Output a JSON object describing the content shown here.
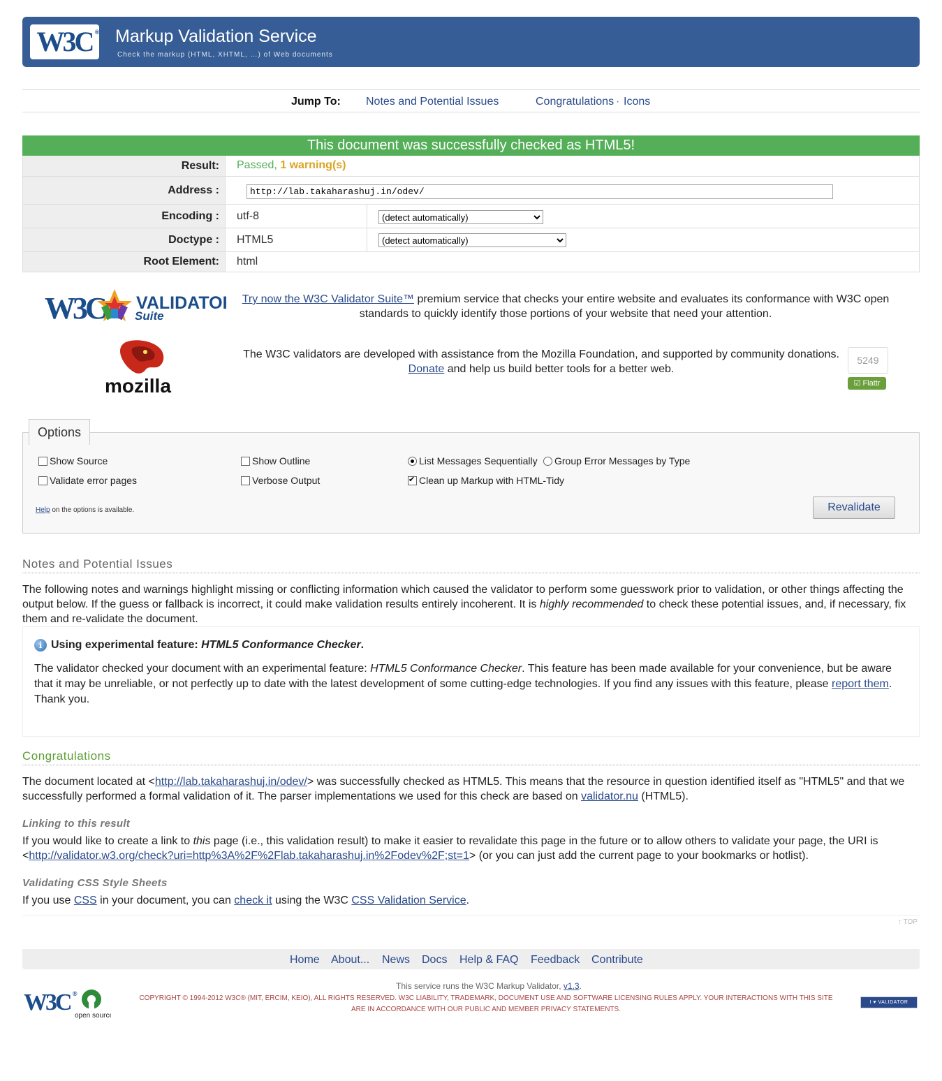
{
  "banner": {
    "title": "Markup Validation Service",
    "subtitle": "Check the markup (HTML, XHTML, …) of Web documents"
  },
  "jump": {
    "label": "Jump To:",
    "notes": "Notes and Potential Issues",
    "congrats": "Congratulations",
    "separator": "·",
    "icons": "Icons"
  },
  "result": {
    "header": "This document was successfully checked as HTML5!",
    "result_label": "Result:",
    "result_passed": "Passed,",
    "result_warning": "1 warning(s)",
    "address_label": "Address :",
    "address_value": "http://lab.takaharashuj.in/odev/",
    "encoding_label": "Encoding :",
    "encoding_value": "utf-8",
    "encoding_select": "(detect automatically)",
    "doctype_label": "Doctype :",
    "doctype_value": "HTML5",
    "doctype_select": "(detect automatically)",
    "root_label": "Root Element:",
    "root_value": "html"
  },
  "promo": {
    "suite_link": "Try now the W3C Validator Suite™",
    "suite_text": " premium service that checks your entire website and evaluates its conformance with W3C open standards to quickly identify those portions of your website that need your attention.",
    "mozilla_text": "The W3C validators are developed with assistance from the Mozilla Foundation, and supported by community donations.",
    "donate_link": "Donate",
    "donate_text": " and help us build better tools for a better web.",
    "donation_count": "5249",
    "flattr_label": "Flattr",
    "mozilla_word": "mozilla",
    "suite_word": "VALIDATOR",
    "suite_sub": "Suite"
  },
  "options": {
    "tab_label": "Options",
    "show_source": "Show Source",
    "show_outline": "Show Outline",
    "list_sequential": "List Messages Sequentially",
    "group_by_type": "Group Error Messages by Type",
    "validate_error_pages": "Validate error pages",
    "verbose_output": "Verbose Output",
    "cleanup_tidy": "Clean up Markup with HTML-Tidy",
    "help_link": "Help",
    "help_text": " on the options is available.",
    "revalidate": "Revalidate"
  },
  "notes": {
    "title": "Notes and Potential Issues",
    "intro_1": "The following notes and warnings highlight missing or conflicting information which caused the validator to perform some guesswork prior to validation, or other things affecting the output below. If the guess or fallback is incorrect, it could make validation results entirely incoherent. It is ",
    "intro_em": "highly recommended",
    "intro_2": " to check these potential issues, and, if necessary, fix them and re-validate the document.",
    "msg_title_1": "Using experimental feature: ",
    "msg_title_em": "HTML5 Conformance Checker",
    "msg_title_2": ".",
    "msg_body_1": "The validator checked your document with an experimental feature: ",
    "msg_body_em": "HTML5 Conformance Checker",
    "msg_body_2": ". This feature has been made available for your convenience, but be aware that it may be unreliable, or not perfectly up to date with the latest development of some cutting-edge technologies. If you find any issues with this feature, please ",
    "msg_body_link": "report them",
    "msg_body_3": ". Thank you."
  },
  "congrats": {
    "title": "Congratulations",
    "text_1": "The document located at <",
    "doc_link": "http://lab.takaharashuj.in/odev/",
    "text_2": "> was successfully checked as HTML5. This means that the resource in question identified itself as \"HTML5\" and that we successfully performed a formal validation of it. The parser implementations we used for this check are based on ",
    "validator_link": "validator.nu",
    "text_3": " (HTML5).",
    "linking_title": "Linking to this result",
    "linking_1": "If you would like to create a link to ",
    "linking_em": "this",
    "linking_2": " page (i.e., this validation result) to make it easier to revalidate this page in the future or to allow others to validate your page, the URI is <",
    "linking_link": "http://validator.w3.org/check?uri=http%3A%2F%2Flab.takaharashuj.in%2Fodev%2F;st=1",
    "linking_3": "> (or you can just add the current page to your bookmarks or hotlist).",
    "css_title": "Validating CSS Style Sheets",
    "css_1": "If you use ",
    "css_link": "CSS",
    "css_2": " in your document, you can ",
    "css_check_link": "check it",
    "css_3": " using the W3C ",
    "css_service_link": "CSS Validation Service",
    "css_4": ".",
    "top_link": "↑ TOP"
  },
  "footer": {
    "nav": [
      "Home",
      "About...",
      "News",
      "Docs",
      "Help & FAQ",
      "Feedback",
      "Contribute"
    ],
    "runs_text": "This service runs the W3C Markup Validator, ",
    "version_link": "v1.3",
    "runs_end": ".",
    "copyright": "COPYRIGHT © 1994-2012 W3C® (MIT, ERCIM, KEIO), ALL RIGHTS RESERVED. W3C LIABILITY, TRADEMARK, DOCUMENT USE AND SOFTWARE LICENSING RULES APPLY. YOUR INTERACTIONS WITH THIS SITE ARE IN ACCORDANCE WITH OUR PUBLIC AND MEMBER PRIVACY STATEMENTS.",
    "badge": "I ♥ VALIDATOR",
    "opensource_label": "open source"
  },
  "colors": {
    "banner": "#365d95",
    "success": "#54af58",
    "warning": "#d9a420",
    "link": "#2a4a8c"
  }
}
